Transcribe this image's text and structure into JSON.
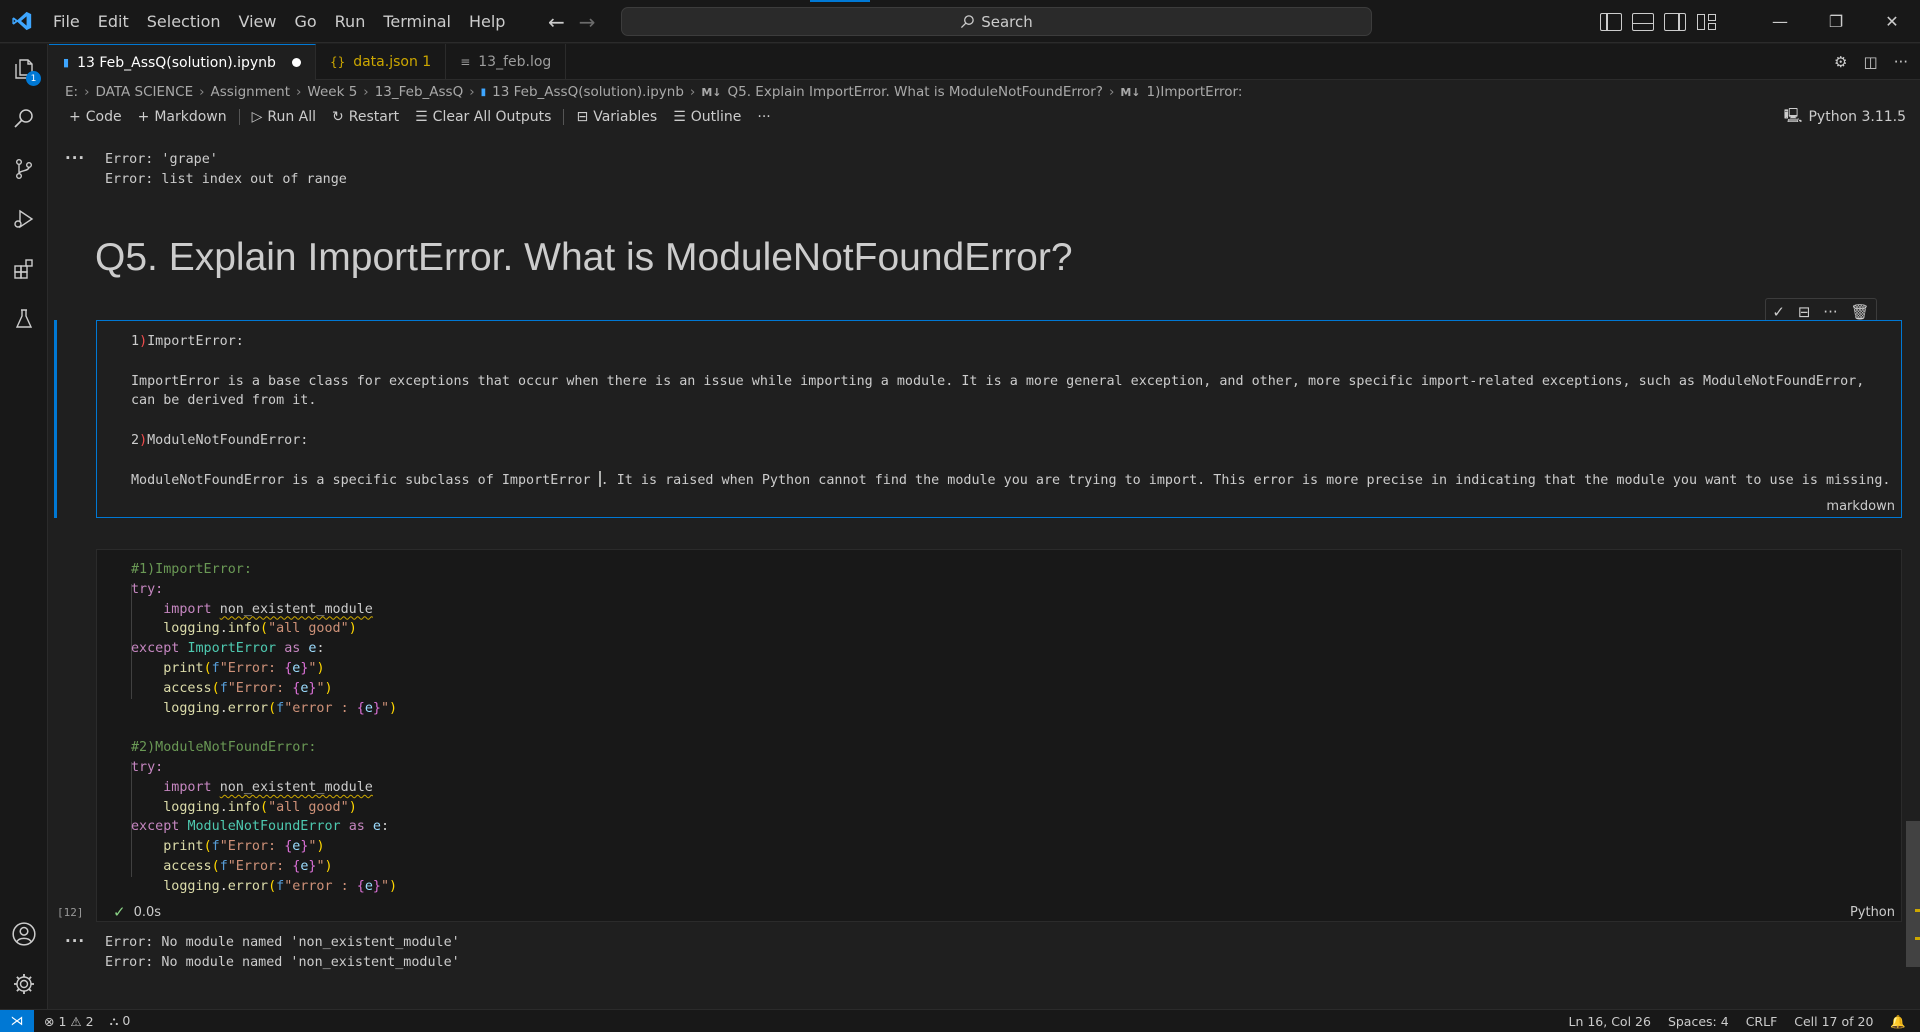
{
  "menu": [
    "File",
    "Edit",
    "Selection",
    "View",
    "Go",
    "Run",
    "Terminal",
    "Help"
  ],
  "search": {
    "label": "Search"
  },
  "tabs": [
    {
      "label": "13 Feb_AssQ(solution).ipynb"
    },
    {
      "label": "data.json 1"
    },
    {
      "label": "13_feb.log"
    }
  ],
  "breadcrumb": [
    "E:",
    "DATA SCIENCE",
    "Assignment",
    "Week 5",
    "13_Feb_AssQ",
    "13 Feb_AssQ(solution).ipynb",
    "Q5. Explain ImportError. What is ModuleNotFoundError?",
    "1)ImportError:"
  ],
  "breadcrumb_md": "M↓",
  "toolbar": {
    "code": "Code",
    "markdown": "Markdown",
    "run_all": "Run All",
    "restart": "Restart",
    "clear": "Clear All Outputs",
    "variables": "Variables",
    "outline": "Outline",
    "more": "···",
    "kernel": "Python 3.11.5"
  },
  "output1": [
    "Error: 'grape'",
    "Error: list index out of range"
  ],
  "heading": "Q5. Explain ImportError. What is ModuleNotFoundError?",
  "markdown_cell": {
    "line1_num": "1",
    "line1_rest": "ImportError:",
    "para1a": "ImportError is a base class for exceptions that occur when there is an issue while importing a module. It is a more general exception, and other, more specific import-related exceptions, such as ModuleNotFoundError,",
    "para1b": "can be derived from it.",
    "line2_num": "2",
    "line2_rest": "ModuleNotFoundError:",
    "para2a": "ModuleNotFoundError is a specific subclass of ImportError ",
    "para2b": ". It is raised when Python cannot find the module you are trying to import. This error is more precise in indicating that the module you want to use is missing.",
    "lang": "markdown"
  },
  "code_cell": {
    "cmt1": "#1)ImportError:",
    "cmt2": "#2)ModuleNotFoundError:",
    "try": "try:",
    "import": "import",
    "module": "non_existent_module",
    "logging": "logging",
    "info": "info",
    "error_fn": "error",
    "all_good": "\"all good\"",
    "except": "except",
    "import_error": "ImportError",
    "module_not_found": "ModuleNotFoundError",
    "as": "as",
    "e": "e",
    "print": "print",
    "access": "access",
    "f_error": "\"Error: ",
    "f_error2": "\"error : ",
    "exec_count": "[12]",
    "exec_time": "0.0s",
    "lang": "Python"
  },
  "output2": [
    "Error: No module named 'non_existent_module'",
    "Error: No module named 'non_existent_module'"
  ],
  "status": {
    "errors": "1",
    "warnings": "2",
    "ports": "0",
    "position": "Ln 16, Col 26",
    "spaces": "Spaces: 4",
    "eol": "CRLF",
    "cell": "Cell 17 of 20"
  },
  "colors": {
    "accent": "#0078d4",
    "background": "#1f1f1f",
    "sidebar": "#181818"
  },
  "icons": [
    "vscode-logo-icon",
    "explorer-icon",
    "search-icon",
    "source-control-icon",
    "run-debug-icon",
    "extensions-icon",
    "testing-icon",
    "account-icon",
    "settings-gear-icon"
  ]
}
